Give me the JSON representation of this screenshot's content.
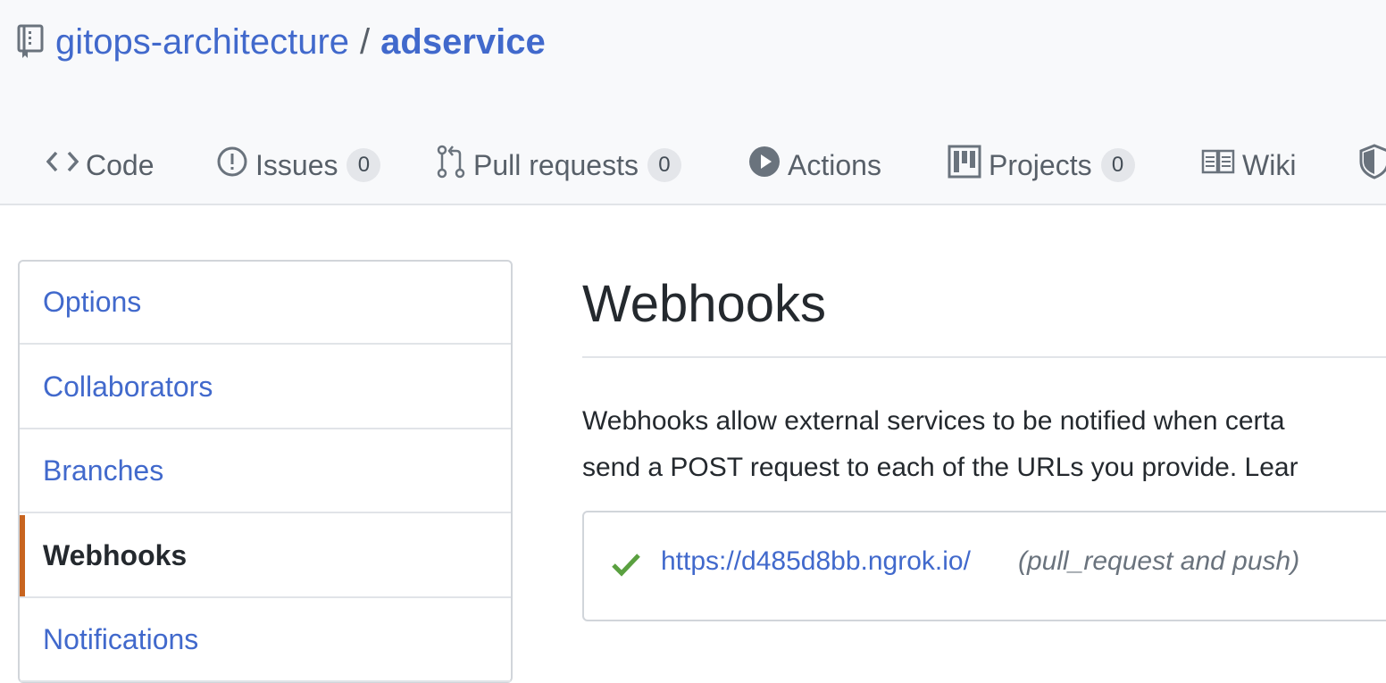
{
  "repo": {
    "owner": "gitops-architecture",
    "separator": "/",
    "name": "adservice"
  },
  "tabs": [
    {
      "label": "Code",
      "icon": "code-icon"
    },
    {
      "label": "Issues",
      "icon": "issue-opened-icon",
      "count": "0"
    },
    {
      "label": "Pull requests",
      "icon": "git-pull-request-icon",
      "count": "0"
    },
    {
      "label": "Actions",
      "icon": "play-icon"
    },
    {
      "label": "Projects",
      "icon": "project-icon",
      "count": "0"
    },
    {
      "label": "Wiki",
      "icon": "book-icon"
    },
    {
      "label": "",
      "icon": "shield-icon"
    }
  ],
  "settings_menu": {
    "items": [
      {
        "label": "Options"
      },
      {
        "label": "Collaborators"
      },
      {
        "label": "Branches"
      },
      {
        "label": "Webhooks",
        "selected": true
      },
      {
        "label": "Notifications"
      }
    ]
  },
  "webhooks": {
    "title": "Webhooks",
    "description_line1": "Webhooks allow external services to be notified when certa",
    "description_line2": "send a POST request to each of the URLs you provide. Lear",
    "hooks": [
      {
        "status_icon": "check-icon",
        "url": "https://d485d8bb.ngrok.io/",
        "events": "(pull_request and push)"
      }
    ]
  },
  "colors": {
    "link": "#4169cc",
    "selected_accent": "#c8641f",
    "success": "#5aa040"
  }
}
